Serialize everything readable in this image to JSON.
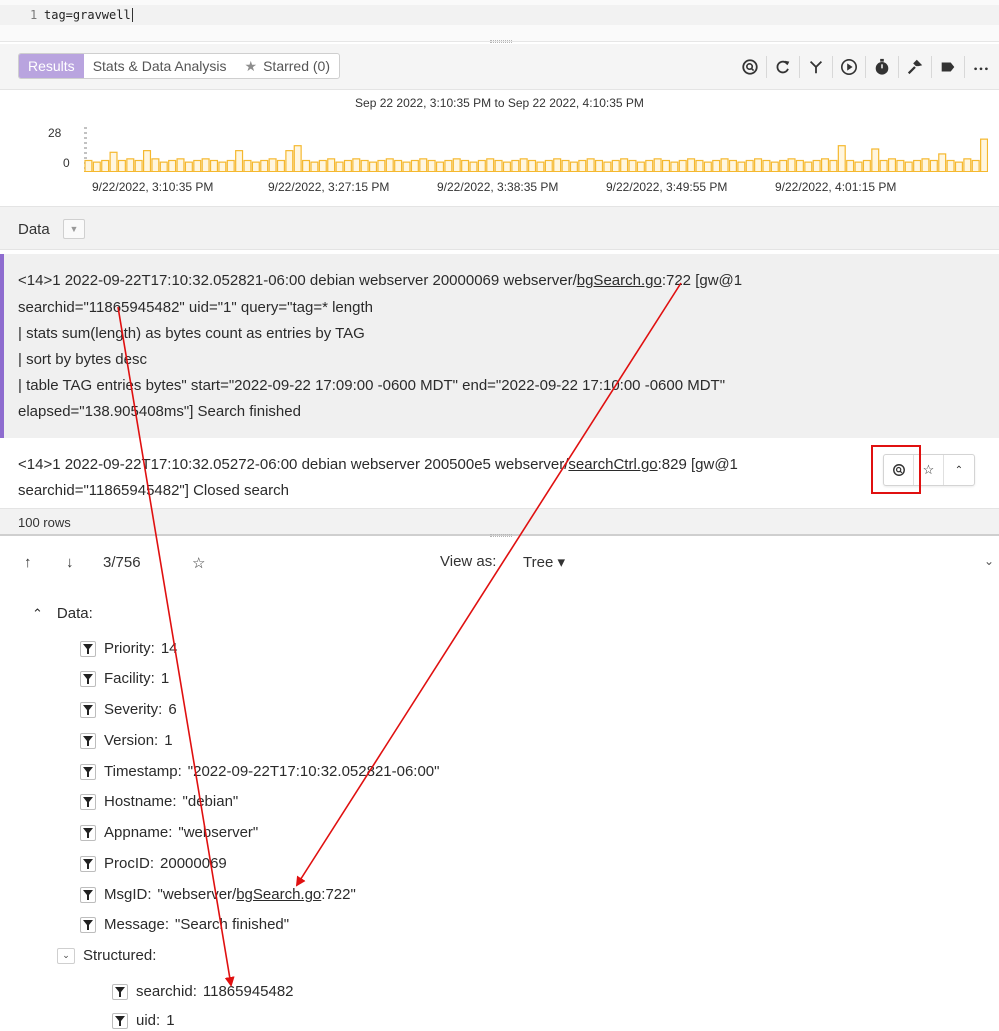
{
  "editor": {
    "line_number": "1",
    "query": "tag=gravwell"
  },
  "tabs": [
    {
      "label": "Results",
      "active": true
    },
    {
      "label": "Stats & Data Analysis",
      "active": false
    },
    {
      "label": "Starred (0)",
      "active": false,
      "icon": "star-icon"
    }
  ],
  "toolbar_icons": [
    "search-sync-icon",
    "refresh-icon",
    "fork-icon",
    "play-circle-icon",
    "stopwatch-icon",
    "hammer-icon",
    "label-tag-icon",
    "more-icon"
  ],
  "histogram": {
    "title": "Sep 22 2022, 3:10:35 PM to Sep 22 2022, 4:10:35 PM",
    "y_max_label": "28",
    "y_min_label": "0",
    "x_labels": [
      "9/22/2022, 3:10:35 PM",
      "9/22/2022, 3:27:15 PM",
      "9/22/2022, 3:38:35 PM",
      "9/22/2022, 3:49:55 PM",
      "9/22/2022, 4:01:15 PM"
    ],
    "bar_color": "#f5b82e",
    "values": [
      7,
      6,
      7,
      12,
      7,
      8,
      7,
      13,
      8,
      6,
      7,
      8,
      6,
      7,
      8,
      7,
      6,
      7,
      13,
      7,
      6,
      7,
      8,
      7,
      13,
      16,
      7,
      6,
      7,
      8,
      6,
      7,
      8,
      7,
      6,
      7,
      8,
      7,
      6,
      7,
      8,
      7,
      6,
      7,
      8,
      7,
      6,
      7,
      8,
      7,
      6,
      7,
      8,
      7,
      6,
      7,
      8,
      7,
      6,
      7,
      8,
      7,
      6,
      7,
      8,
      7,
      6,
      7,
      8,
      7,
      6,
      7,
      8,
      7,
      6,
      7,
      8,
      7,
      6,
      7,
      8,
      7,
      6,
      7,
      8,
      7,
      6,
      7,
      8,
      7,
      16,
      7,
      6,
      7,
      14,
      7,
      8,
      7,
      6,
      7,
      8,
      7,
      11,
      7,
      6,
      8,
      7,
      20
    ]
  },
  "data_header": {
    "label": "Data"
  },
  "entry1": {
    "line1_pre": "<14>1 2022-09-22T17:10:32.052821-06:00 debian webserver 20000069 webserver/",
    "line1_link": "bgSearch.go",
    "line1_post": ":722 [gw@1",
    "line2": "searchid=\"11865945482\" uid=\"1\" query=\"tag=* length",
    "line3": "| stats sum(length) as bytes count as entries by TAG",
    "line4": "| sort by bytes desc",
    "line5": "| table TAG entries bytes\" start=\"2022-09-22 17:09:00 -0600 MDT\" end=\"2022-09-22 17:10:00 -0600 MDT\"",
    "line6": "elapsed=\"138.905408ms\"] Search finished"
  },
  "entry2": {
    "line1_pre": "<14>1 2022-09-22T17:10:32.05272-06:00 debian webserver 200500e5 webserver/",
    "line1_link": "searchCtrl.go",
    "line1_post": ":829 [gw@1",
    "line2": "searchid=\"11865945482\"] Closed search"
  },
  "rows_count": "100 rows",
  "detail": {
    "up": "↑",
    "down": "↓",
    "position": "3/756",
    "view_as_label": "View as:",
    "view_mode": "Tree ▾"
  },
  "tree": {
    "root_label": "Data:",
    "fields": [
      {
        "key": "Priority:",
        "value": "14"
      },
      {
        "key": "Facility:",
        "value": "1"
      },
      {
        "key": "Severity:",
        "value": "6"
      },
      {
        "key": "Version:",
        "value": "1"
      },
      {
        "key": "Timestamp:",
        "value": "\"2022-09-22T17:10:32.052821-06:00\""
      },
      {
        "key": "Hostname:",
        "value": "\"debian\""
      },
      {
        "key": "Appname:",
        "value": "\"webserver\""
      },
      {
        "key": "ProcID:",
        "value": "20000069"
      },
      {
        "key": "MsgID:",
        "value_pre": "\"webserver/",
        "value_link": "bgSearch.go",
        "value_post": ":722\""
      },
      {
        "key": "Message:",
        "value": "\"Search finished\""
      }
    ],
    "structured_label": "Structured:",
    "structured_fields": [
      {
        "key": "searchid:",
        "value": "11865945482"
      },
      {
        "key": "uid:",
        "value": "1"
      }
    ]
  },
  "annotation_color": "#e01010"
}
